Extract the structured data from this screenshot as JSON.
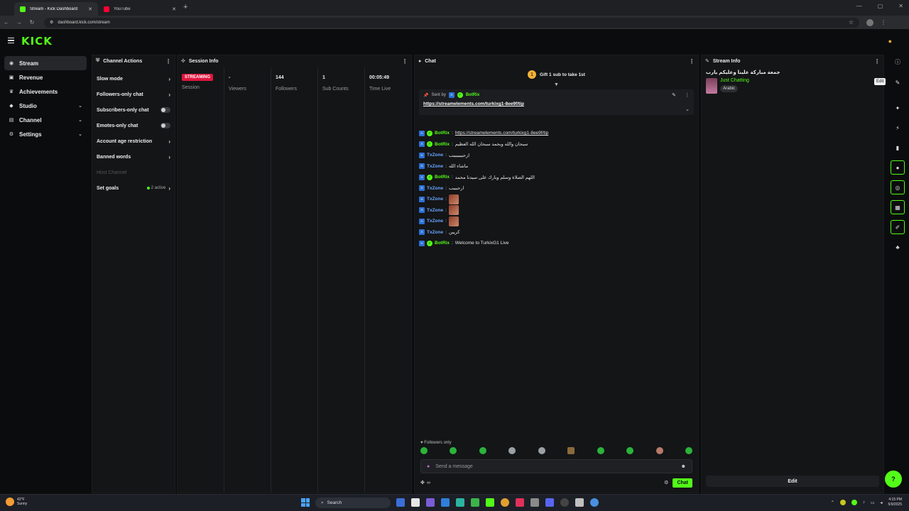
{
  "browser": {
    "tabs": [
      {
        "label": "Stream - Kick Dashboard",
        "active": true,
        "color": "#53fc18"
      },
      {
        "label": "YouTube",
        "active": false,
        "color": "#ff0033"
      }
    ],
    "url": "dashboard.kick.com/stream"
  },
  "app": {
    "logo": "KICK",
    "colors": {
      "accent": "#53fc18",
      "live": "#e0163f"
    }
  },
  "nav": {
    "items": [
      {
        "label": "Stream",
        "icon": "broadcast-icon",
        "active": true,
        "expandable": false
      },
      {
        "label": "Revenue",
        "icon": "revenue-icon",
        "active": false,
        "expandable": false
      },
      {
        "label": "Achievements",
        "icon": "trophy-icon",
        "active": false,
        "expandable": false
      },
      {
        "label": "Studio",
        "icon": "studio-icon",
        "active": false,
        "expandable": true
      },
      {
        "label": "Channel",
        "icon": "channel-icon",
        "active": false,
        "expandable": true
      },
      {
        "label": "Settings",
        "icon": "gear-icon",
        "active": false,
        "expandable": true
      }
    ]
  },
  "channel_actions": {
    "title": "Channel Actions",
    "items": [
      {
        "label": "Slow mode",
        "control": "arrow"
      },
      {
        "label": "Followers-only chat",
        "control": "arrow"
      },
      {
        "label": "Subscribers-only chat",
        "control": "toggle"
      },
      {
        "label": "Emotes-only chat",
        "control": "toggle"
      },
      {
        "label": "Account age restriction",
        "control": "arrow"
      },
      {
        "label": "Banned words",
        "control": "arrow"
      },
      {
        "label": "Host Channel",
        "control": "disabled"
      },
      {
        "label": "Set goals",
        "control": "goals",
        "extra": "2 active"
      }
    ]
  },
  "session_info": {
    "title": "Session Info",
    "stats": [
      {
        "value": "STREAMING",
        "label": "Session"
      },
      {
        "value": "-",
        "label": "Viewers"
      },
      {
        "value": "144",
        "label": "Followers"
      },
      {
        "value": "1",
        "label": "Sub Counts"
      },
      {
        "value": "00:05:49",
        "label": "Time Live"
      }
    ]
  },
  "chat": {
    "title": "Chat",
    "gift": {
      "count": "1",
      "text": "Gift 1 sub to take 1st"
    },
    "pinned": {
      "sent_by_label": "Sent by",
      "user": "BotRix",
      "link": "https://streamelements.com/turkixg1-8ee9f/tip"
    },
    "messages": [
      {
        "user": "BotRix",
        "color": "green",
        "text": "https://streamelements.com/turkixg1-8ee9f/tip",
        "link": true,
        "verified": true
      },
      {
        "user": "BotRix",
        "color": "green",
        "text": "سبحان والله وبحمد سبحان الله العظيم",
        "verified": true
      },
      {
        "user": "TxZone",
        "color": "blue",
        "text": "ارحبببببببب"
      },
      {
        "user": "TxZone",
        "color": "blue",
        "text": "ماشاء الله"
      },
      {
        "user": "BotRix",
        "color": "green",
        "text": "اللهم الصلاة وسلم وبارك على سيدنا محمد",
        "verified": true
      },
      {
        "user": "TxZone",
        "color": "blue",
        "text": "ارحبببب"
      },
      {
        "user": "TxZone",
        "color": "blue",
        "text": "",
        "emote": true
      },
      {
        "user": "TxZone",
        "color": "blue",
        "text": "",
        "emote": true
      },
      {
        "user": "TxZone",
        "color": "blue",
        "text": "",
        "emote": true
      },
      {
        "user": "TxZone",
        "color": "blue",
        "text": "كريين"
      },
      {
        "user": "BotRix",
        "color": "green",
        "text": "Welcome to TurkixG1 Live",
        "verified": true
      }
    ],
    "followers_only": "Followers only",
    "input_placeholder": "Send a message",
    "send_label": "Chat",
    "infinity": "∞"
  },
  "stream_info": {
    "title": "Stream Info",
    "stream_title": "جمعة مباركة علينا وعليكم يارب",
    "category": "Just Chatting",
    "tag": "Arabic",
    "edit_label": "Edit",
    "tooltip": "Edit"
  },
  "taskbar": {
    "weather_temp": "42°F",
    "weather_desc": "Sunny",
    "search_label": "Search",
    "time": "4:15 PM",
    "date": "5/9/2025"
  }
}
